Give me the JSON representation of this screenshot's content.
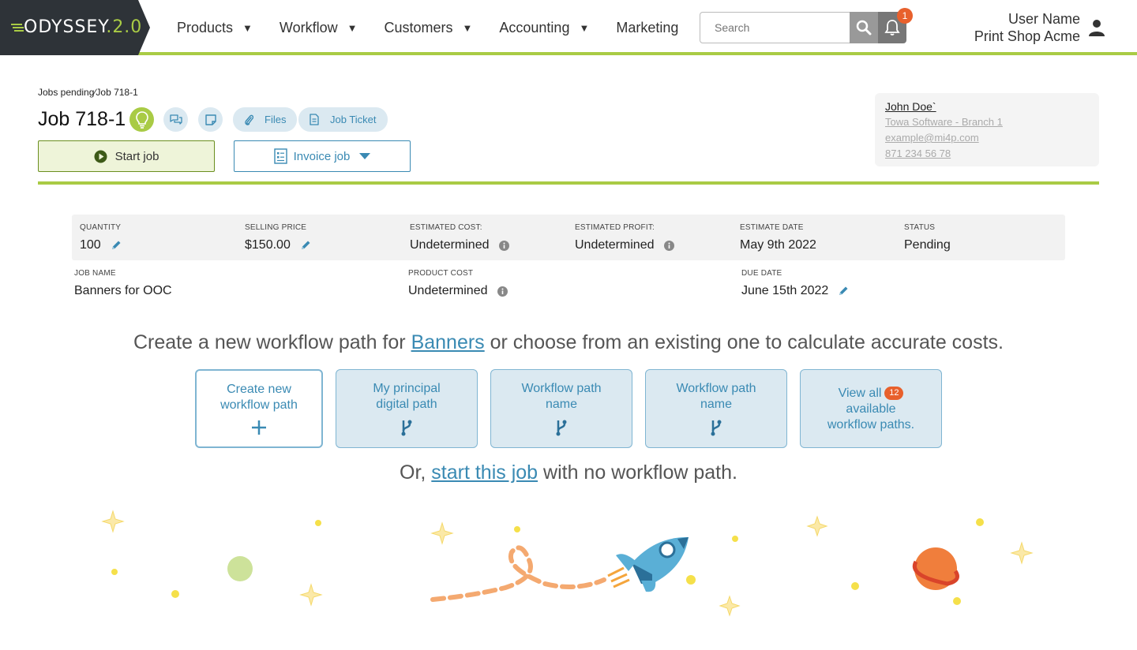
{
  "header": {
    "logo_text": "ODYSSEY",
    "logo_version": "2.0",
    "nav": [
      {
        "label": "Products",
        "caret": "▼"
      },
      {
        "label": "Workflow",
        "caret": "▼"
      },
      {
        "label": "Customers",
        "caret": "▼"
      },
      {
        "label": "Accounting",
        "caret": "▼"
      },
      {
        "label": "Marketing",
        "caret": ""
      }
    ],
    "search_placeholder": "Search",
    "notification_count": "1",
    "user_name": "User Name",
    "company": "Print Shop Acme"
  },
  "job": {
    "breadcrumb": "Jobs pending∕Job 718-1",
    "title": "Job 718-1",
    "files_label": "Files",
    "ticket_label": "Job Ticket",
    "start_label": "Start job",
    "invoice_label": "Invoice job"
  },
  "contact": {
    "name": "John Doe`",
    "company": "Towa Software - Branch 1",
    "email": "example@mi4p.com",
    "phone": "871 234 56 78"
  },
  "info": {
    "quantity": {
      "label": "QUANTITY",
      "value": "100"
    },
    "selling_price": {
      "label": "SELLING PRICE",
      "value": "$150.00"
    },
    "estimated_cost": {
      "label": "ESTIMATED COST:",
      "value": "Undetermined"
    },
    "estimated_profit": {
      "label": "ESTIMATED PROFIT:",
      "value": "Undetermined"
    },
    "estimate_date": {
      "label": "ESTIMATE DATE",
      "value": "May 9th 2022"
    },
    "status": {
      "label": "STATUS",
      "value": "Pending"
    },
    "job_name": {
      "label": "JOB NAME",
      "value": "Banners for OOC"
    },
    "product_cost": {
      "label": "PRODUCT COST",
      "value": "Undetermined"
    },
    "due_date": {
      "label": "DUE DATE",
      "value": "June 15th 2022"
    }
  },
  "workflow": {
    "heading_pre": "Create a new workflow path for ",
    "heading_link": "Banners",
    "heading_post": " or choose from an existing one to calculate accurate costs.",
    "cards": [
      {
        "line1": "Create new",
        "line2": "workflow path"
      },
      {
        "line1": "My principal",
        "line2": "digital path"
      },
      {
        "line1": "Workflow path",
        "line2": "name"
      },
      {
        "line1": "Workflow path",
        "line2": "name"
      },
      {
        "line1": "View all",
        "badge": "12",
        "line2": "available",
        "line3": "workflow paths."
      }
    ],
    "or_pre": "Or, ",
    "or_link": "start this job",
    "or_post": " with no workflow path."
  },
  "colors": {
    "brand_green": "#a9cb45",
    "link_blue": "#3a8ab3",
    "card_bg": "#dbe9f1",
    "badge_orange": "#e8602c",
    "logo_dark": "#2e3338"
  }
}
